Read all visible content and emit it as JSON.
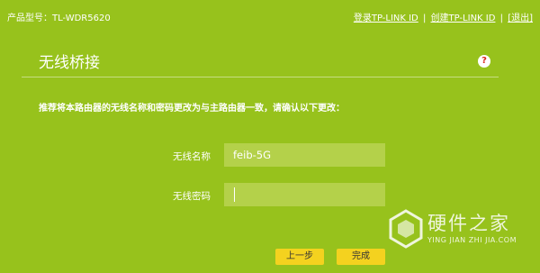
{
  "header": {
    "model_text": "产品型号：TL-WDR5620",
    "login_link": "登录TP-LINK ID",
    "create_link": "创建TP-LINK ID",
    "exit_link": "[退出]",
    "separator": "|"
  },
  "page": {
    "title": "无线桥接",
    "help_glyph": "?",
    "instruction": "推荐将本路由器的无线名称和密码更改为与主路由器一致，请确认以下更改："
  },
  "form": {
    "ssid_label": "无线名称",
    "ssid_value": "feib-5G",
    "password_label": "无线密码",
    "password_value": ""
  },
  "buttons": {
    "prev_label": "上一步",
    "done_label": "完成"
  },
  "watermark": {
    "name": "硬件之家",
    "pinyin": "YING JIAN ZHI JIA.COM"
  },
  "colors": {
    "background": "#97c21c",
    "input_background": "#b4d14a",
    "button": "#f4d21f",
    "help_icon": "#d9261c"
  }
}
